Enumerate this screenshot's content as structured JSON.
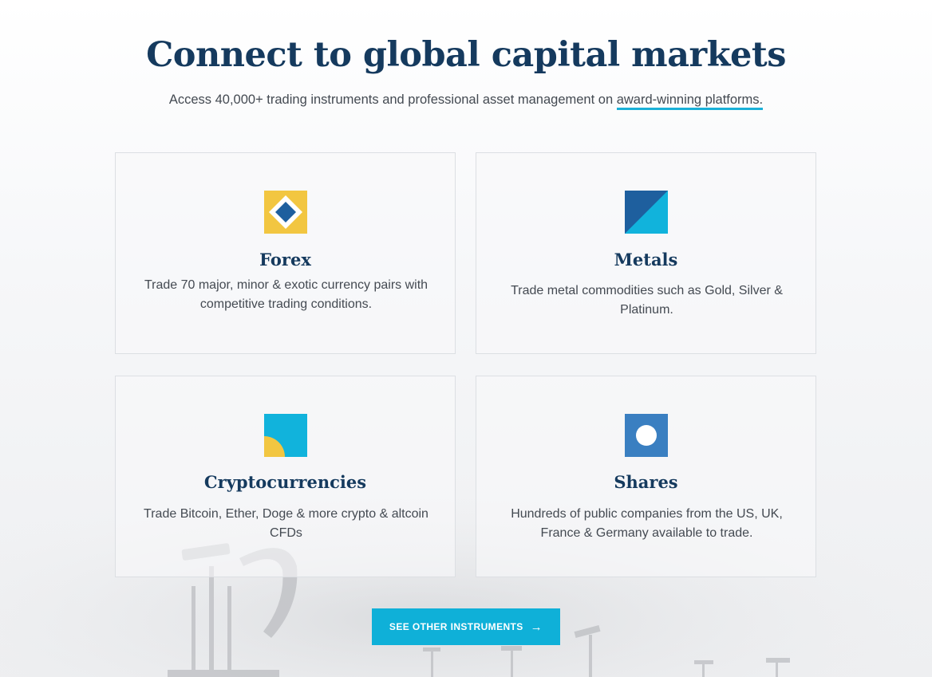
{
  "hero": {
    "title": "Connect to global capital markets",
    "subtitle_text": "Access 40,000+ trading instruments and professional asset management on ",
    "subtitle_link": "award-winning platforms."
  },
  "cards": [
    {
      "title": "Forex",
      "description": "Trade 70 major, minor & exotic currency pairs with competitive trading conditions.",
      "icon": "forex-icon"
    },
    {
      "title": "Metals",
      "description": "Trade metal commodities such as Gold, Silver & Platinum.",
      "icon": "metals-icon"
    },
    {
      "title": "Cryptocurrencies",
      "description": "Trade Bitcoin, Ether, Doge & more crypto & altcoin CFDs",
      "icon": "crypto-icon"
    },
    {
      "title": "Shares",
      "description": "Hundreds of public companies from the US, UK, France & Germany available to trade.",
      "icon": "shares-icon"
    }
  ],
  "cta": {
    "label": "SEE OTHER INSTRUMENTS",
    "icon": "arrow-right-icon"
  },
  "colors": {
    "heading": "#153a5e",
    "accent": "#0fb0d8",
    "yellow": "#f2c641",
    "dark_blue": "#1e5f9e",
    "mid_blue": "#3a7fc1"
  }
}
